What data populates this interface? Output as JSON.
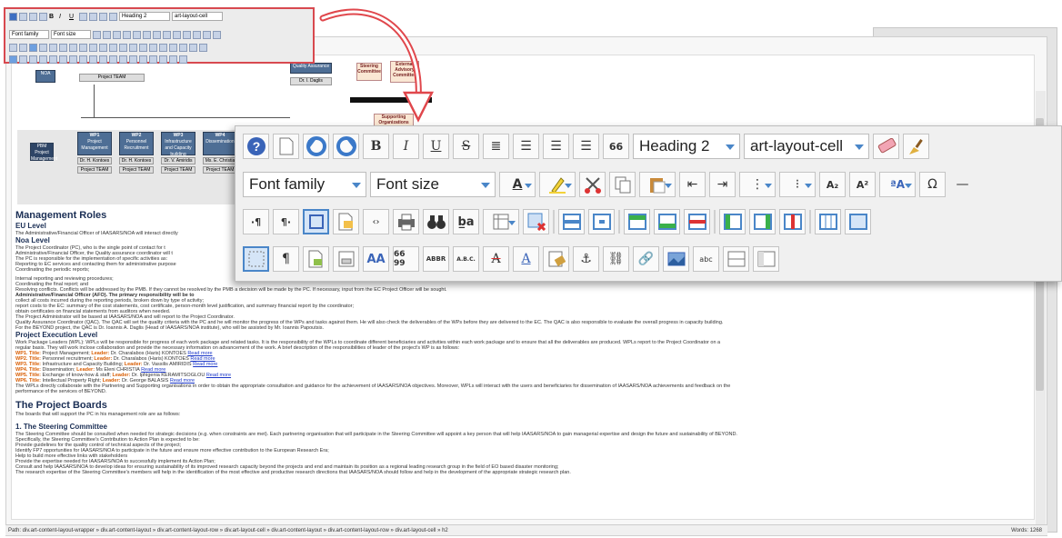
{
  "mini_toolbar": {
    "block_format": "Heading 2",
    "style_class": "art-layout-cell",
    "font_family": "Font family",
    "font_size": "Font size"
  },
  "toolbar": {
    "row1": {
      "bold": "B",
      "italic": "I",
      "underline": "U",
      "strike": "S",
      "quote": "66",
      "block_format": "Heading 2",
      "style_class": "art-layout-cell"
    },
    "row2": {
      "font_family": "Font family",
      "font_size": "Font size",
      "font_color": "A",
      "subscript": "A₂",
      "superscript": "A²",
      "case": "ªA",
      "special_char": "Ω"
    },
    "row3": {
      "ltr": "·¶",
      "rtl": "¶·",
      "find_replace": "b̲a"
    },
    "row4": {
      "paragraph": "¶",
      "styles": "AA",
      "cite": "66 99",
      "abbr": "ABBR",
      "acronym": "A.B.C.",
      "clear_strike": "A",
      "underline_a": "A",
      "spellcheck": "abc"
    }
  },
  "org_chart": {
    "noa": "NOA",
    "project_team": "Project TEAM",
    "quality_assurance": "Quality Assurance",
    "qa_person": "Dr. I. Daglis",
    "steering": "Steering Committee",
    "advisory": "External Advisory Committee",
    "supporting": "Supporting Organizations",
    "pbm": "PBM Project Management",
    "wps": [
      {
        "id": "WP1",
        "title": "Project Management",
        "leader": "Dr. H. Kontoes",
        "team": "Project TEAM"
      },
      {
        "id": "WP2",
        "title": "Personnel Recruitment",
        "leader": "Dr. H. Kontoes",
        "team": "Project TEAM"
      },
      {
        "id": "WP3",
        "title": "Infrastructure and Capacity building",
        "leader": "Dr. V. Amiridis",
        "team": "Project TEAM"
      },
      {
        "id": "WP4",
        "title": "Dissemination",
        "leader": "Ms. E. Christia",
        "team": "Project TEAM"
      }
    ]
  },
  "content": {
    "h_management": "Management Roles",
    "h_eu": "EU Level",
    "eu_text": "The Administrative/Financial Officer of IAASARS/NOA will interact directly",
    "h_noa": "Noa Level",
    "pc_lead": "The Project Coordinator (PC), who is the single point of contact for t",
    "pc_2": "Administrative/Financial Officer, the Quality assurance coordinator will t",
    "pc_3": "The PC is responsible for the implementation of specific activities as:",
    "b1": "Reporting to EC services and contacting them for administrative purpose",
    "b2": "Coordinating the periodic reports;",
    "b3": "Internal reporting and reviewing procedures;",
    "b4": "Coordinating the final report; and",
    "b5": "Resolving conflicts. Conflicts will be addressed by the PMB. If they cannot be resolved by the PMB a decision will be made by the PC. If necessary, input from the EC Project Officer will be sought.",
    "afo": "Administrative/Financial Officer (AFO). The primary responsibility will be to",
    "a1": "collect all costs incurred during the reporting periods, broken down by type of activity;",
    "a2": "report costs to the EC: summary of the cost statements, cost certificate, person-month level justification, and summary financial report by the coordinator;",
    "a3": "obtain certificates on financial statements from auditors when needed.",
    "a4": "The Project Administrator will be based at IAASARS/NOA and will report to the Project Coordinator.",
    "qac": "Quality Assurance Coordinator (QAC). The QAC will set the quality criteria with the PC and he will monitor the progress of the WPs and tasks against them. He will also check the deliverables of the WPs before they are delivered to the EC. The QAC is also responsible to evaluate the overall progress in capacity building.",
    "qac2": "For the BEYOND project, the QAC is Dr. Ioannis A. Daglis (Head of IAASARS/NOA institute), who will be assisted by Mr. Ioannis Papoutsis.",
    "h_exec": "Project Execution Level",
    "wpl": "Work Package Leaders (WPL): WPLs will be responsible for progress of each work package and related tasks. It is the responsibility of the WPLs to coordinate different beneficiaries and activities within each work package and to ensure that all the deliverables are produced. WPLs report to the Project Coordinator on a",
    "wpl2": "regular basis. They will work inclose collaboration and provide the necessary information on advancement of the work. A brief description of the responsibilities of leader of the project's WP is as follows:",
    "wp_list": [
      {
        "wp": "WP1. Title:",
        "title": " Project Management; ",
        "lead": "Leader:",
        "name": " Dr. Charalabos (Haris) KONTOES ",
        "more": "Read more"
      },
      {
        "wp": "WP2. Title:",
        "title": " Personnel recruitment; ",
        "lead": "Leader:",
        "name": " Dr. Charalabos (Haris) KONTOES ",
        "more": "Read more"
      },
      {
        "wp": "WP3. Title:",
        "title": " Infrastructure and Capacity Building; ",
        "lead": "Leader:",
        "name": " Dr. Vassilis AMIRIDIS ",
        "more": "Read more"
      },
      {
        "wp": "WP4. Title:",
        "title": " Dissemination; ",
        "lead": "Leader:",
        "name": " Ms Eleni CHRISTIA ",
        "more": "Read more"
      },
      {
        "wp": "WP5. Title:",
        "title": " Exchange of know-how & staff; ",
        "lead": "Leader:",
        "name": " Dr. Iphigenia KERAMITSOGLOU ",
        "more": "Read more"
      },
      {
        "wp": "WP6. Title:",
        "title": " Intellectual Property Right; ",
        "lead": "Leader:",
        "name": " Dr. George BALASIS ",
        "more": "Read more"
      }
    ],
    "wpl3": "The WPLs directly collaborate with the Partnering and Supporting organisations in order to obtain the appropriate consultation and guidance for the achievement of IAASARS/NOA objectives. Moreover, WPLs will interact with the users and beneficiaries for dissemination of IAASARS/NOA achievements and feedback on the",
    "wpl4": "performance of the services of BEYOND.",
    "h_boards": "The Project Boards",
    "boards_text": "The boards that will support the PC in his management role are as follows:",
    "h_steering": "1. The Steering Committee",
    "s1": "The Steering Committee should be consulted when needed for strategic decisions (e.g. when constraints are met). Each partnering organisation that will participate in the Steering Committee will appoint a key person that will help IAASARS/NOA to gain managerial expertise and design the future and sustainability of BEYOND.",
    "s2": "Specifically, the Steering Committee's Contribution to Action Plan is expected to be:",
    "s3": "Provide guidelines for the quality control of technical aspects of the project;",
    "s4": "Identify FP7 opportunities for IAASARS/NOA to participate in the future and ensure more effective contribution to the European Research Era;",
    "s5": "Help to build more effective links with stakeholders",
    "s6": "Provide the expertise needed for IAASARS/NOA to successfully implement its Action Plan;",
    "s7": "Consult and help IAASARS/NOA to develop ideas for ensuring sustainability of its improved research capacity beyond the projects and end and maintain its position as a regional leading research group in the field of EO based disaster monitoring;",
    "s8": "The research expertise of the Steering Committee's members will help in the identification of the most effective and productive research directions that IAASARS/NOA should follow and help in the development of the appropriate strategic research plan."
  },
  "status": {
    "path": "Path: div.art-content-layout-wrapper » div.art-content-layout » div.art-content-layout-row » div.art-layout-cell » div.art-content-layout » div.art-content-layout-row » div.art-layout-cell » h2",
    "words": "Words: 1268"
  }
}
